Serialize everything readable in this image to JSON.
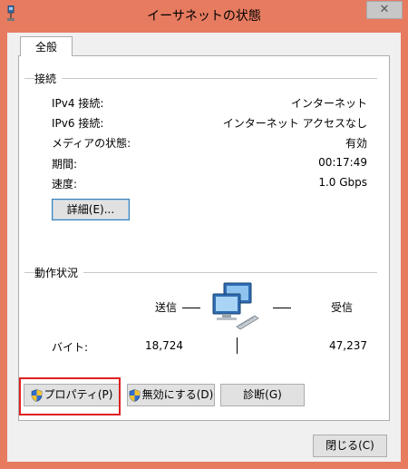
{
  "window": {
    "title": "イーサネットの状態",
    "close_glyph": "✕"
  },
  "tabs": [
    {
      "label": "全般",
      "selected": true
    }
  ],
  "connection": {
    "group_title": "接続",
    "rows": [
      {
        "label": "IPv4 接続:",
        "value": "インターネット"
      },
      {
        "label": "IPv6 接続:",
        "value": "インターネット アクセスなし"
      },
      {
        "label": "メディアの状態:",
        "value": "有効"
      },
      {
        "label": "期間:",
        "value": "00:17:49"
      },
      {
        "label": "速度:",
        "value": "1.0 Gbps"
      }
    ],
    "details_button": "詳細(E)..."
  },
  "activity": {
    "group_title": "動作状況",
    "sent_label": "送信",
    "received_label": "受信",
    "bytes_label": "バイト:",
    "sent_value": "18,724",
    "received_value": "47,237"
  },
  "buttons": {
    "properties": "プロパティ(P)",
    "disable": "無効にする(D)",
    "diagnose": "診断(G)",
    "close": "閉じる(C)"
  },
  "icons": {
    "app": "network-icon",
    "network_activity": "network-computers-icon",
    "shield": "uac-shield-icon"
  },
  "colors": {
    "frame": "#e67b60",
    "highlight": "#e02020"
  }
}
